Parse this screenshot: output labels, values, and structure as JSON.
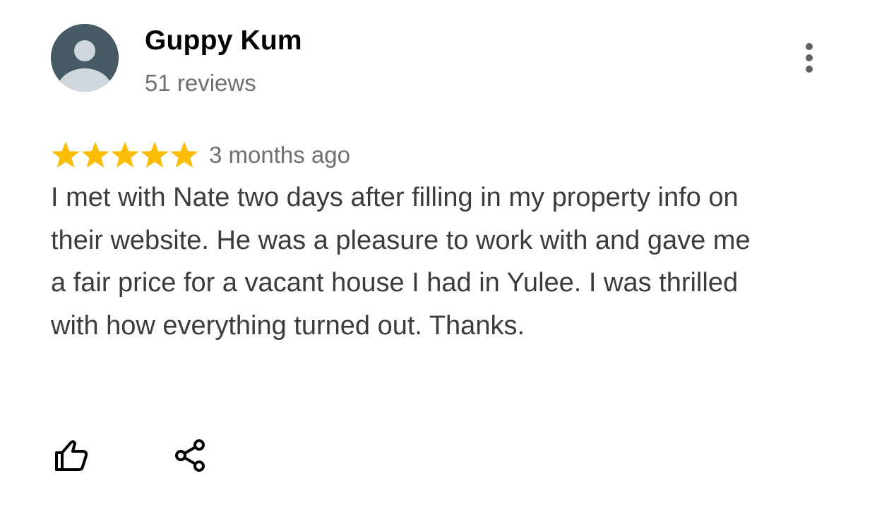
{
  "review": {
    "author": {
      "name": "Guppy Kum",
      "review_count": "51 reviews",
      "avatar_icon": "default-person-avatar"
    },
    "rating": {
      "stars": 5,
      "max_stars": 5,
      "star_color": "#fbbc04",
      "date": "3 months ago"
    },
    "text": "I met with Nate two days after filling in my property info on their website. He was a pleasure to work with and gave me a fair price for a vacant house I had in Yulee. I was thrilled with how everything turned out. Thanks.",
    "actions": {
      "like_icon": "thumbs-up-icon",
      "share_icon": "share-icon",
      "more_icon": "more-vertical-icon"
    }
  },
  "colors": {
    "avatar_bg": "#455a64",
    "avatar_figure": "#cfd8dc",
    "name": "#000000",
    "secondary_text": "#6f6f6f",
    "body_text": "#3c3c3c",
    "icon": "#000000"
  }
}
